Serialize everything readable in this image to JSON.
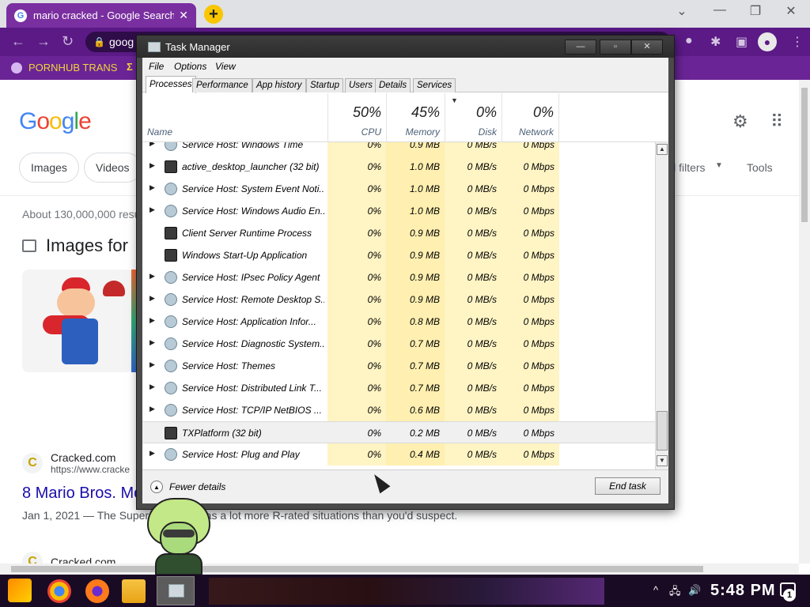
{
  "browser": {
    "tab_title": "mario cracked - Google Search",
    "tab_close": "✕",
    "new_tab": "+",
    "omnibox_text": "goog",
    "bookmark_label": "PORNHUB TRANS",
    "bookmark_extra": "Σ",
    "window_controls": [
      "⌄",
      "—",
      "❐",
      "✕"
    ],
    "accent_color": "#5b1a86"
  },
  "google": {
    "logo": [
      "G",
      "o",
      "o",
      "g",
      "l",
      "e"
    ],
    "chips": [
      "Images",
      "Videos"
    ],
    "filters_label": "ll filters",
    "tools_label": "Tools",
    "results_stats": "About 130,000,000 resu",
    "images_heading": "Images for",
    "results": [
      {
        "site": "Cracked.com",
        "url": "https://www.cracke",
        "title": "8 Mario Bros. Mo",
        "snippet": "Jan 1, 2021 — The Super M        nchise has a lot more R-rated situations than you'd suspect."
      },
      {
        "site": "Cracked.com"
      }
    ]
  },
  "task_manager": {
    "title": "Task Manager",
    "menu": [
      "File",
      "Options",
      "View"
    ],
    "tabs": [
      "Processes",
      "Performance",
      "App history",
      "Startup",
      "Users",
      "Details",
      "Services"
    ],
    "active_tab": "Processes",
    "columns": {
      "name": "Name",
      "cpu": {
        "label": "CPU",
        "pct": "50%"
      },
      "memory": {
        "label": "Memory",
        "pct": "45%"
      },
      "disk": {
        "label": "Disk",
        "pct": "0%"
      },
      "network": {
        "label": "Network",
        "pct": "0%"
      }
    },
    "processes": [
      {
        "name": "Service Host: Windows Time",
        "cpu": "0%",
        "mem": "0.9 MB",
        "disk": "0 MB/s",
        "net": "0 Mbps",
        "expandable": true,
        "icon": "gear-icon"
      },
      {
        "name": "active_desktop_launcher (32 bit)",
        "cpu": "0%",
        "mem": "1.0 MB",
        "disk": "0 MB/s",
        "net": "0 Mbps",
        "expandable": true,
        "icon": "app-icon"
      },
      {
        "name": "Service Host: System Event Noti...",
        "cpu": "0%",
        "mem": "1.0 MB",
        "disk": "0 MB/s",
        "net": "0 Mbps",
        "expandable": true,
        "icon": "gear-icon"
      },
      {
        "name": "Service Host: Windows Audio En...",
        "cpu": "0%",
        "mem": "1.0 MB",
        "disk": "0 MB/s",
        "net": "0 Mbps",
        "expandable": true,
        "icon": "gear-icon"
      },
      {
        "name": "Client Server Runtime Process",
        "cpu": "0%",
        "mem": "0.9 MB",
        "disk": "0 MB/s",
        "net": "0 Mbps",
        "expandable": false,
        "icon": "app-icon"
      },
      {
        "name": "Windows Start-Up Application",
        "cpu": "0%",
        "mem": "0.9 MB",
        "disk": "0 MB/s",
        "net": "0 Mbps",
        "expandable": false,
        "icon": "app-icon"
      },
      {
        "name": "Service Host: IPsec Policy Agent",
        "cpu": "0%",
        "mem": "0.9 MB",
        "disk": "0 MB/s",
        "net": "0 Mbps",
        "expandable": true,
        "icon": "gear-icon"
      },
      {
        "name": "Service Host: Remote Desktop S...",
        "cpu": "0%",
        "mem": "0.9 MB",
        "disk": "0 MB/s",
        "net": "0 Mbps",
        "expandable": true,
        "icon": "gear-icon"
      },
      {
        "name": "Service Host: Application Infor...",
        "cpu": "0%",
        "mem": "0.8 MB",
        "disk": "0 MB/s",
        "net": "0 Mbps",
        "expandable": true,
        "icon": "gear-icon"
      },
      {
        "name": "Service Host: Diagnostic System...",
        "cpu": "0%",
        "mem": "0.7 MB",
        "disk": "0 MB/s",
        "net": "0 Mbps",
        "expandable": true,
        "icon": "gear-icon"
      },
      {
        "name": "Service Host: Themes",
        "cpu": "0%",
        "mem": "0.7 MB",
        "disk": "0 MB/s",
        "net": "0 Mbps",
        "expandable": true,
        "icon": "gear-icon"
      },
      {
        "name": "Service Host: Distributed Link T...",
        "cpu": "0%",
        "mem": "0.7 MB",
        "disk": "0 MB/s",
        "net": "0 Mbps",
        "expandable": true,
        "icon": "gear-icon"
      },
      {
        "name": "Service Host: TCP/IP NetBIOS ...",
        "cpu": "0%",
        "mem": "0.6 MB",
        "disk": "0 MB/s",
        "net": "0 Mbps",
        "expandable": true,
        "icon": "gear-icon"
      },
      {
        "name": "TXPlatform (32 bit)",
        "cpu": "0%",
        "mem": "0.2 MB",
        "disk": "0 MB/s",
        "net": "0 Mbps",
        "expandable": false,
        "icon": "app-icon",
        "selected": true
      },
      {
        "name": "Service Host: Plug and Play",
        "cpu": "0%",
        "mem": "0.4 MB",
        "disk": "0 MB/s",
        "net": "0 Mbps",
        "expandable": true,
        "icon": "gear-icon"
      }
    ],
    "fewer_details": "Fewer details",
    "end_task": "End task"
  },
  "taskbar": {
    "clock": "5:48 PM",
    "notification_count": "1"
  }
}
